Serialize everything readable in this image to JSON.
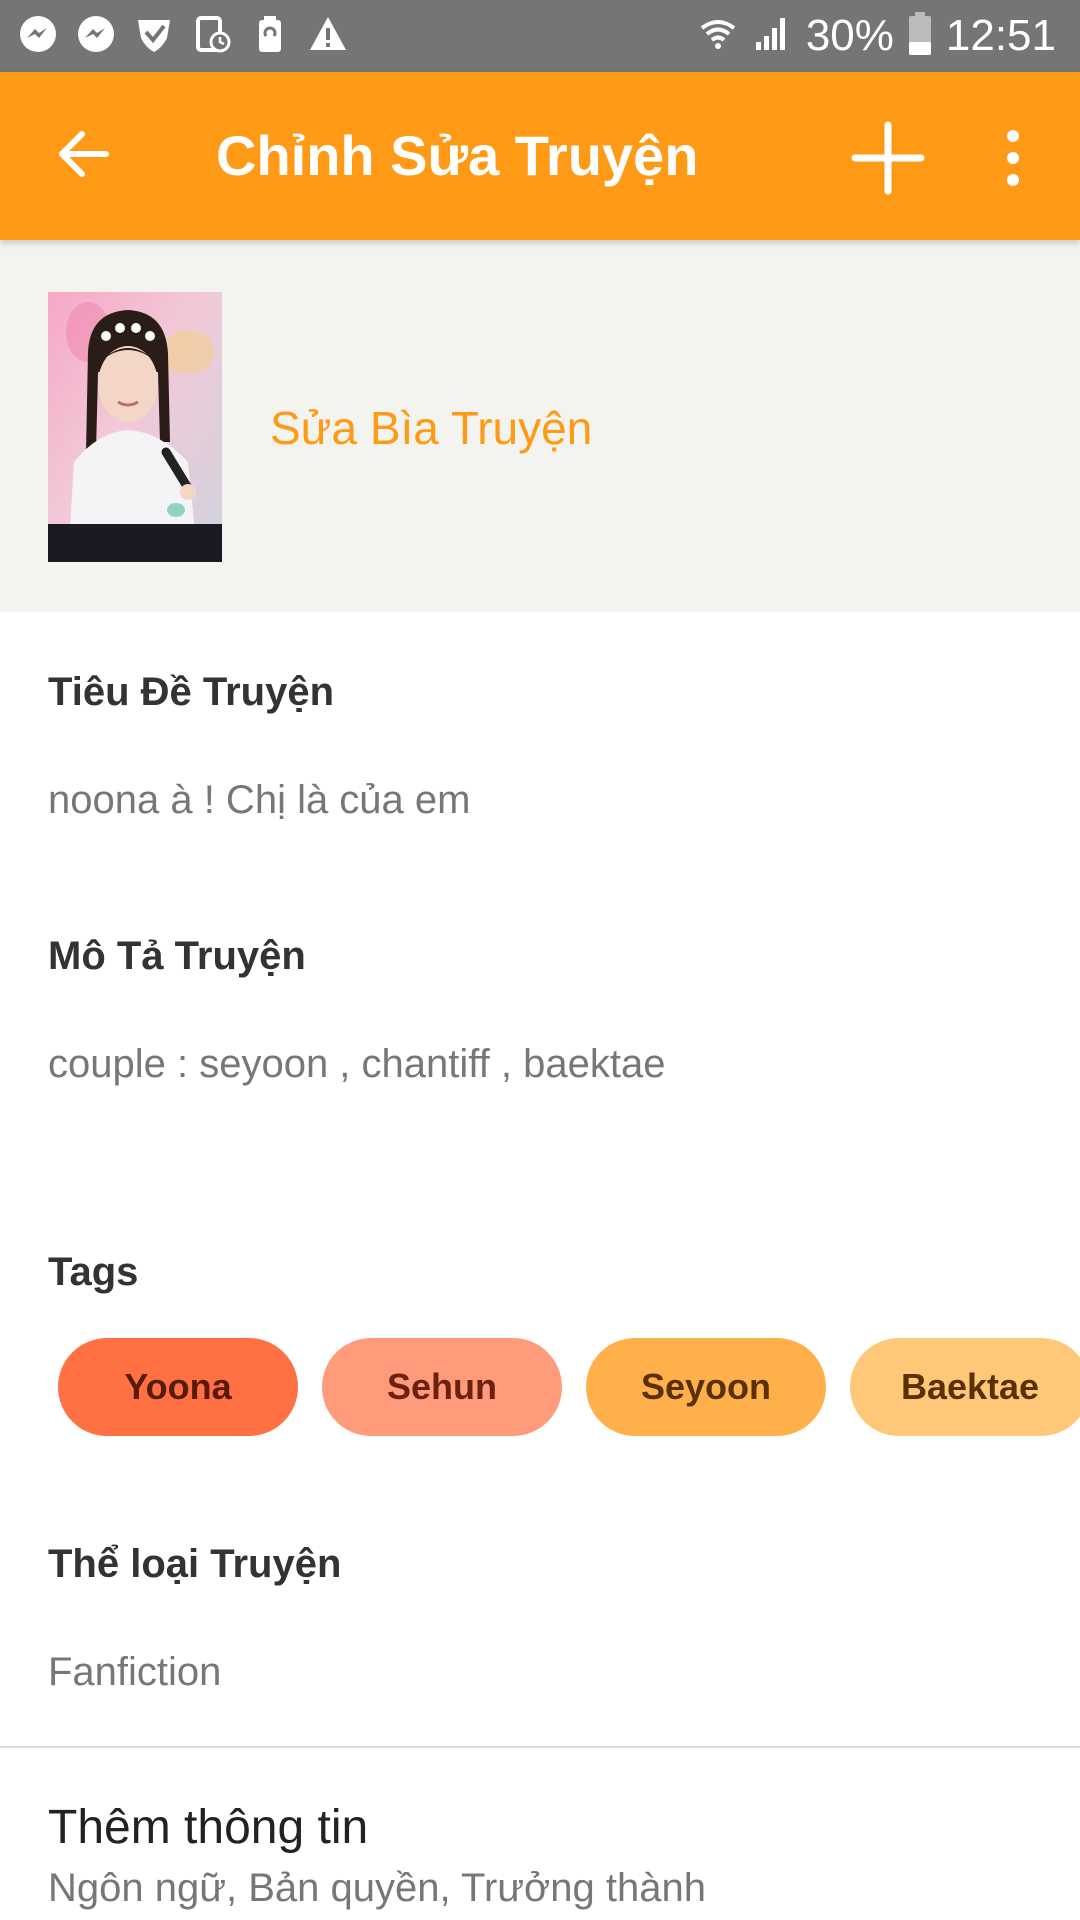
{
  "status_bar": {
    "icons": [
      "messenger-icon",
      "messenger-icon",
      "shield-icon",
      "device-clock-icon",
      "battery-saver-icon",
      "warning-icon"
    ],
    "battery": "30%",
    "time": "12:51"
  },
  "app_bar": {
    "title": "Chỉnh Sửa Truyện",
    "back_icon": "arrow-left-icon",
    "add_icon": "plus-icon",
    "more_icon": "more-vert-icon"
  },
  "cover": {
    "edit_label": "Sửa Bìa Truyện"
  },
  "fields": {
    "title_label": "Tiêu Đề Truyện",
    "title_value": "noona à ! Chị là của em",
    "description_label": "Mô Tả Truyện",
    "description_value": "couple : seyoon , chantiff , baektae",
    "tags_label": "Tags",
    "genre_label": "Thể loại Truyện",
    "genre_value": "Fanfiction"
  },
  "tags": [
    {
      "label": "Yoona",
      "bg": "#ff7043",
      "fg": "#5a1a08"
    },
    {
      "label": "Sehun",
      "bg": "#ff9a7a",
      "fg": "#6b2010"
    },
    {
      "label": "Seyoon",
      "bg": "#ffb04a",
      "fg": "#5a3000"
    },
    {
      "label": "Baektae",
      "bg": "#ffc878",
      "fg": "#5a3000"
    }
  ],
  "more_info": {
    "title": "Thêm thông tin",
    "subtitle": "Ngôn ngữ, Bản quyền, Trưởng thành"
  },
  "colors": {
    "accent": "#ff9a17",
    "status_bar": "#757575",
    "cover_bg": "#f3f3ef"
  }
}
